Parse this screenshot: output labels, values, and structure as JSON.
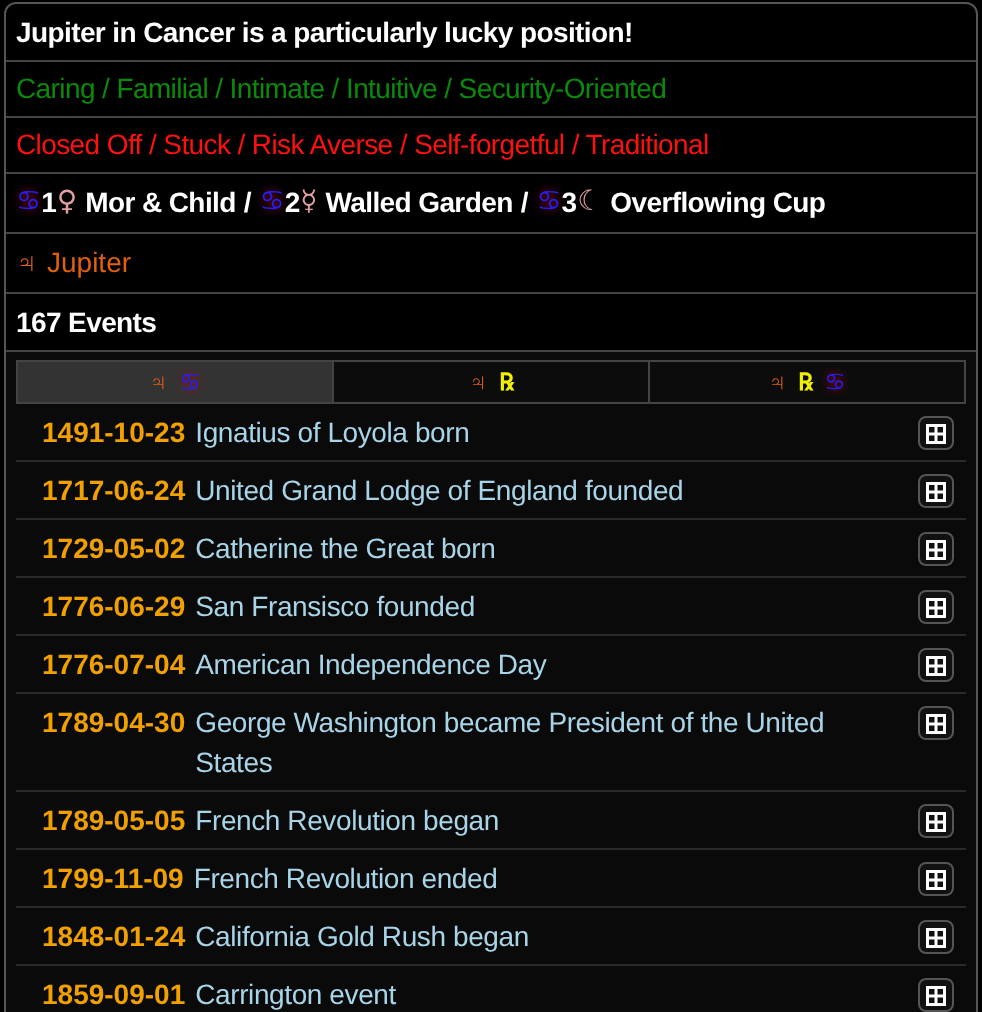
{
  "headline": "Jupiter in Cancer is a particularly lucky position!",
  "positive_traits": "Caring / Familial / Intimate / Intuitive / Security-Oriented",
  "negative_traits": "Closed Off / Stuck / Risk Averse / Self-forgetful / Traditional",
  "decan_separator": "/",
  "decans": [
    {
      "sign": "♋",
      "number": "1",
      "ruler": "♀",
      "label": "Mor & Child"
    },
    {
      "sign": "♋",
      "number": "2",
      "ruler": "☿",
      "label": "Walled Garden"
    },
    {
      "sign": "♋",
      "number": "3",
      "ruler": "☾",
      "label": "Overflowing Cup"
    }
  ],
  "planet": {
    "symbol": "♃",
    "name": "Jupiter"
  },
  "event_count": "167 Events",
  "tabs": [
    {
      "selected": true,
      "glyphs": [
        {
          "kind": "planet",
          "text": "♃"
        },
        {
          "kind": "sign",
          "text": "♋"
        }
      ]
    },
    {
      "selected": false,
      "glyphs": [
        {
          "kind": "planet",
          "text": "♃"
        },
        {
          "kind": "retrograde",
          "text": "℞"
        }
      ]
    },
    {
      "selected": false,
      "glyphs": [
        {
          "kind": "planet",
          "text": "♃"
        },
        {
          "kind": "retrograde",
          "text": "℞"
        },
        {
          "kind": "sign",
          "text": "♋"
        }
      ]
    }
  ],
  "events": [
    {
      "date": "1491-10-23",
      "title": "Ignatius of Loyola born"
    },
    {
      "date": "1717-06-24",
      "title": "United Grand Lodge of England founded"
    },
    {
      "date": "1729-05-02",
      "title": "Catherine the Great born"
    },
    {
      "date": "1776-06-29",
      "title": "San Fransisco founded"
    },
    {
      "date": "1776-07-04",
      "title": "American Independence Day"
    },
    {
      "date": "1789-04-30",
      "title": "George Washington became President of the United States"
    },
    {
      "date": "1789-05-05",
      "title": "French Revolution began"
    },
    {
      "date": "1799-11-09",
      "title": "French Revolution ended"
    },
    {
      "date": "1848-01-24",
      "title": "California Gold Rush began"
    },
    {
      "date": "1859-09-01",
      "title": "Carrington event"
    }
  ]
}
